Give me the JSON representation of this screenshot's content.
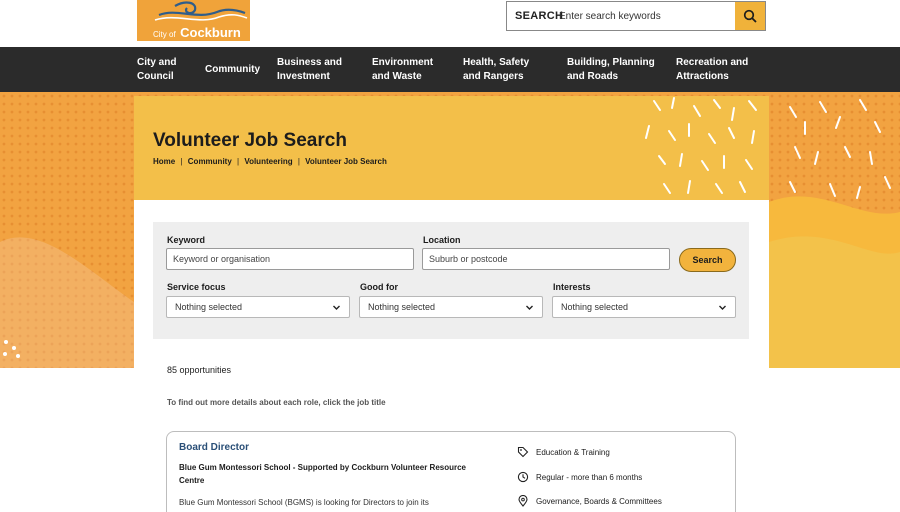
{
  "header": {
    "logo_small": "City of",
    "logo_big": "Cockburn",
    "search_label": "SEARCH",
    "search_placeholder": "Enter search keywords"
  },
  "nav": {
    "items": [
      {
        "line1": "City and",
        "line2": "Council"
      },
      {
        "line1": "Community",
        "line2": ""
      },
      {
        "line1": "Business and",
        "line2": "Investment"
      },
      {
        "line1": "Environment",
        "line2": "and Waste"
      },
      {
        "line1": "Health, Safety",
        "line2": "and Rangers"
      },
      {
        "line1": "Building, Planning",
        "line2": "and Roads"
      },
      {
        "line1": "Recreation and",
        "line2": "Attractions"
      }
    ]
  },
  "hero": {
    "title": "Volunteer Job Search",
    "breadcrumb": [
      "Home",
      "Community",
      "Volunteering",
      "Volunteer Job Search"
    ]
  },
  "form": {
    "keyword_label": "Keyword",
    "keyword_placeholder": "Keyword or organisation",
    "location_label": "Location",
    "location_placeholder": "Suburb or postcode",
    "search_button": "Search",
    "service_focus_label": "Service focus",
    "service_focus_value": "Nothing selected",
    "good_for_label": "Good for",
    "good_for_value": "Nothing selected",
    "interests_label": "Interests",
    "interests_value": "Nothing selected"
  },
  "results": {
    "count_text": "85 opportunities",
    "hint": "To find out more details about each role, click the job title"
  },
  "card": {
    "title": "Board Director",
    "org": "Blue Gum Montessori School - Supported by Cockburn Volunteer Resource Centre",
    "desc": "Blue Gum Montessori School (BGMS) is looking for Directors to join its",
    "meta": [
      {
        "icon": "tag-icon",
        "text": "Education & Training"
      },
      {
        "icon": "clock-icon",
        "text": "Regular - more than 6 months"
      },
      {
        "icon": "location-pin-icon",
        "text": "Governance, Boards & Committees"
      }
    ]
  },
  "colors": {
    "brand_orange": "#f0a33a",
    "hero_yellow": "#f3bf49",
    "nav_dark": "#2b2b2b",
    "link_blue": "#2a4f77"
  }
}
